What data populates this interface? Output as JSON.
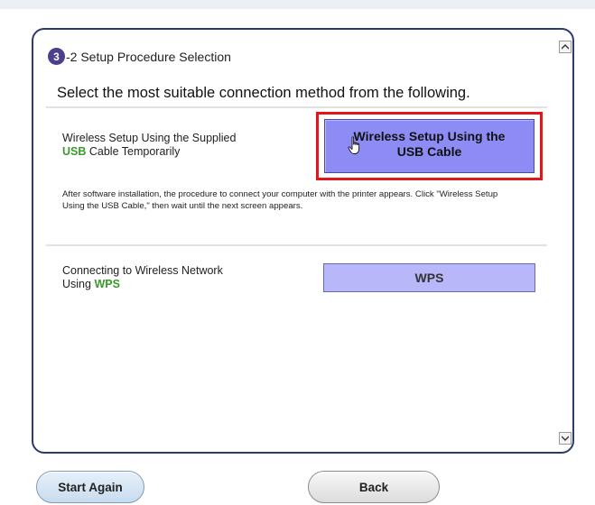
{
  "step": {
    "number": "3",
    "title": "-2 Setup Procedure Selection"
  },
  "instruction": "Select the most suitable connection method from the following.",
  "option_usb": {
    "label_line1": "Wireless Setup Using the Supplied",
    "label_highlight": "USB",
    "label_rest": " Cable Temporarily",
    "button_line1": "Wireless Setup Using the",
    "button_line2": "USB Cable",
    "description": "After software installation, the procedure to connect your computer with the printer appears. Click \"Wireless Setup Using the USB Cable,\" then wait until the next screen appears."
  },
  "option_wps": {
    "label_line1": "Connecting to Wireless Network",
    "label_prefix": "Using ",
    "label_highlight": "WPS",
    "button_label": "WPS"
  },
  "footer": {
    "start_again_label": "Start Again",
    "back_label": "Back"
  },
  "colors": {
    "frame_border": "#2e3a6e",
    "step_circle": "#4b3f8e",
    "highlight_text": "#3a9a2a",
    "selected_button": "#8c8cf4",
    "wps_button": "#b7b7f9",
    "selection_outline": "#e2161a"
  },
  "icons": {
    "cursor": "hand-pointer-icon",
    "scroll_up": "scroll-up-arrow-icon",
    "scroll_down": "scroll-down-arrow-icon"
  }
}
